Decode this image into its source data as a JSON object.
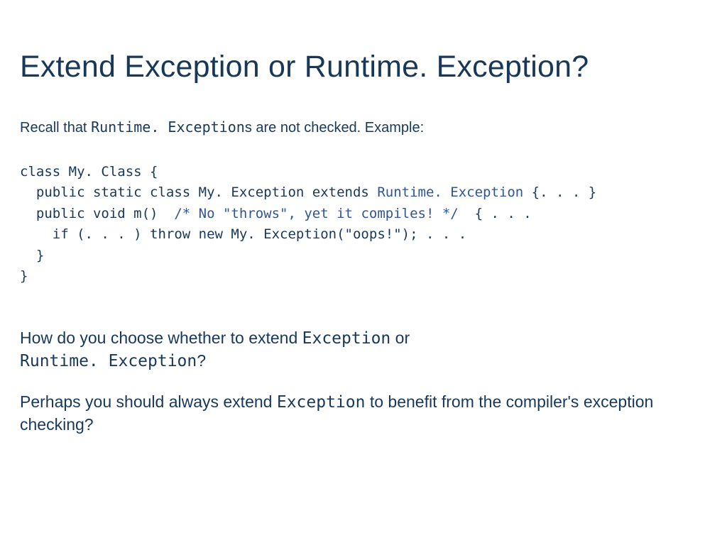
{
  "title": "Extend Exception or Runtime. Exception?",
  "intro_pre": "Recall that ",
  "intro_code": "Runtime. Exception",
  "intro_post": "s are not checked.  Example:",
  "code": {
    "l1": "class My. Class {",
    "l2a": "  public static class My. Exception extends ",
    "l2b": "Runtime. Exception",
    "l2c": " {. . . }",
    "l3a": "  public void m()  ",
    "l3b": "/* No \"throws\", yet it compiles! */",
    "l3c": "  { . . .",
    "l4": "    if (. . . ) throw new My. Exception(\"oops!\"); . . .",
    "l5": "  }",
    "l6": "}"
  },
  "q1_pre": "How do you choose whether to extend ",
  "q1_code1": "Exception",
  "q1_mid": " or ",
  "q1_code2": "Runtime. Exception",
  "q1_post": "?",
  "q2_pre": "Perhaps you should always extend ",
  "q2_code": "Exception",
  "q2_post": "  to benefit from the compiler's exception checking?"
}
